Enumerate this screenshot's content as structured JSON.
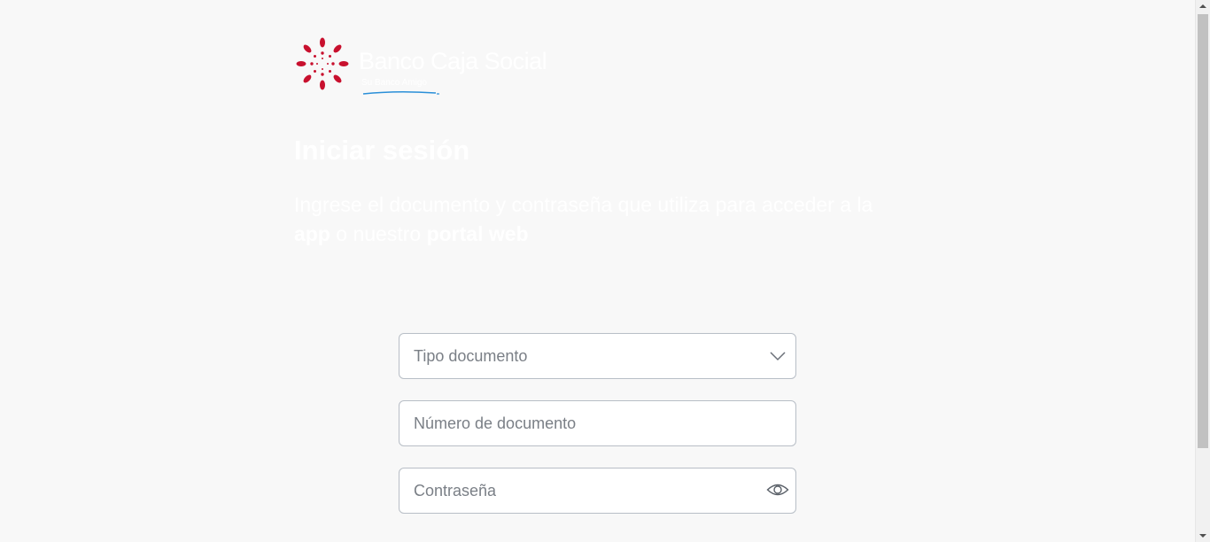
{
  "brand": {
    "name": "Banco Caja Social",
    "tagline": "Su Banco Amigo",
    "primary_color": "#c8102e",
    "accent_color": "#2a8fd8"
  },
  "login": {
    "title": "Iniciar sesión",
    "subtitle_part1": "Ingrese el documento y contraseña que utiliza para acceder a la ",
    "subtitle_app": "app",
    "subtitle_part2": " o nuestro ",
    "subtitle_portal": "portal web"
  },
  "form": {
    "doc_type": {
      "selected_text": "Tipo documento",
      "icon": "chevron-down-icon"
    },
    "doc_number": {
      "placeholder": "Número de documento",
      "value": ""
    },
    "password": {
      "placeholder": "Contraseña",
      "value": "",
      "icon": "eye-icon"
    }
  }
}
